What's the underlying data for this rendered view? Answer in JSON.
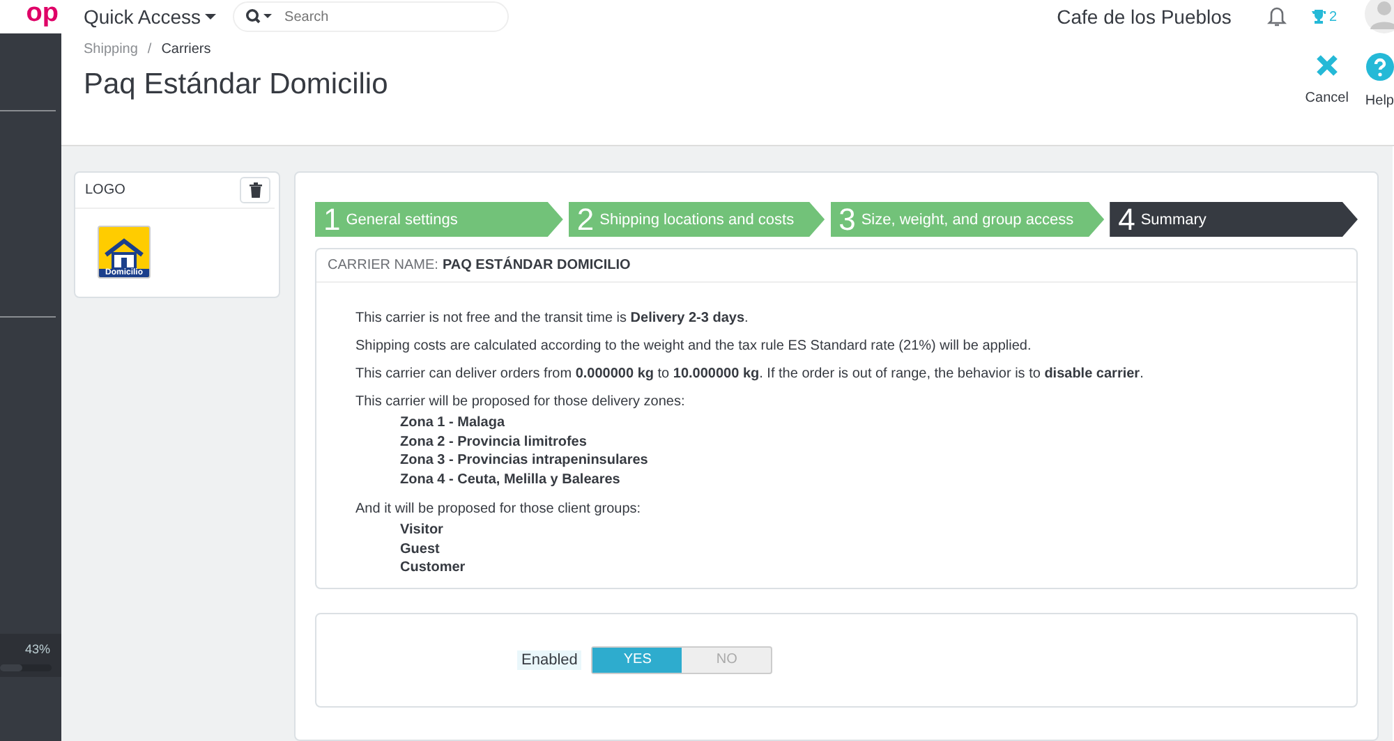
{
  "brand": "op",
  "topbar": {
    "quick_access": "Quick Access",
    "search": {
      "placeholder": "Search"
    },
    "shop_name": "Cafe de los Pueblos",
    "trophy_count": "2"
  },
  "sidebar": {
    "progress": {
      "reading": "43%",
      "level": 0.43
    }
  },
  "breadcrumb": [
    "Shipping",
    "Carriers"
  ],
  "breadcrumb_separator": "/",
  "page_title": "Paq Estándar Domicilio",
  "toolbar": [
    {
      "kind": "cancel",
      "label": "Cancel"
    },
    {
      "kind": "help",
      "label": "Help"
    }
  ],
  "logo_panel": {
    "title": "LOGO",
    "logo_text": "Domicilio"
  },
  "steps": [
    {
      "number": "1",
      "label": "General settings",
      "selected": false
    },
    {
      "number": "2",
      "label": "Shipping locations and costs",
      "selected": false
    },
    {
      "number": "3",
      "label": "Size, weight, and group access",
      "selected": false
    },
    {
      "number": "4",
      "label": "Summary",
      "selected": true
    }
  ],
  "summary": {
    "heading_label": "CARRIER NAME:",
    "heading_value": "PAQ ESTÁNDAR DOMICILIO",
    "sentences": [
      "This carrier is not free and the transit time is **Delivery 2-3 days**.",
      "Shipping costs are calculated according to the weight and the tax rule ES Standard rate (21%) will be applied.",
      "This carrier can deliver orders from **0.000000 kg** to **10.000000 kg**. If the order is out of range, the behavior is to **disable carrier**."
    ],
    "zones_intro": "This carrier will be proposed for those delivery zones:",
    "zones": [
      "Zona 1 - Malaga",
      "Zona 2 - Provincia limitrofes",
      "Zona 3 - Provincias intrapeninsulares",
      "Zona 4 - Ceuta, Melilla y Baleares"
    ],
    "groups_intro": "And it will be proposed for those client groups:",
    "groups": [
      "Visitor",
      "Guest",
      "Customer"
    ]
  },
  "enabled": {
    "label": "Enabled",
    "on": true,
    "yes": "YES",
    "no": "NO"
  }
}
